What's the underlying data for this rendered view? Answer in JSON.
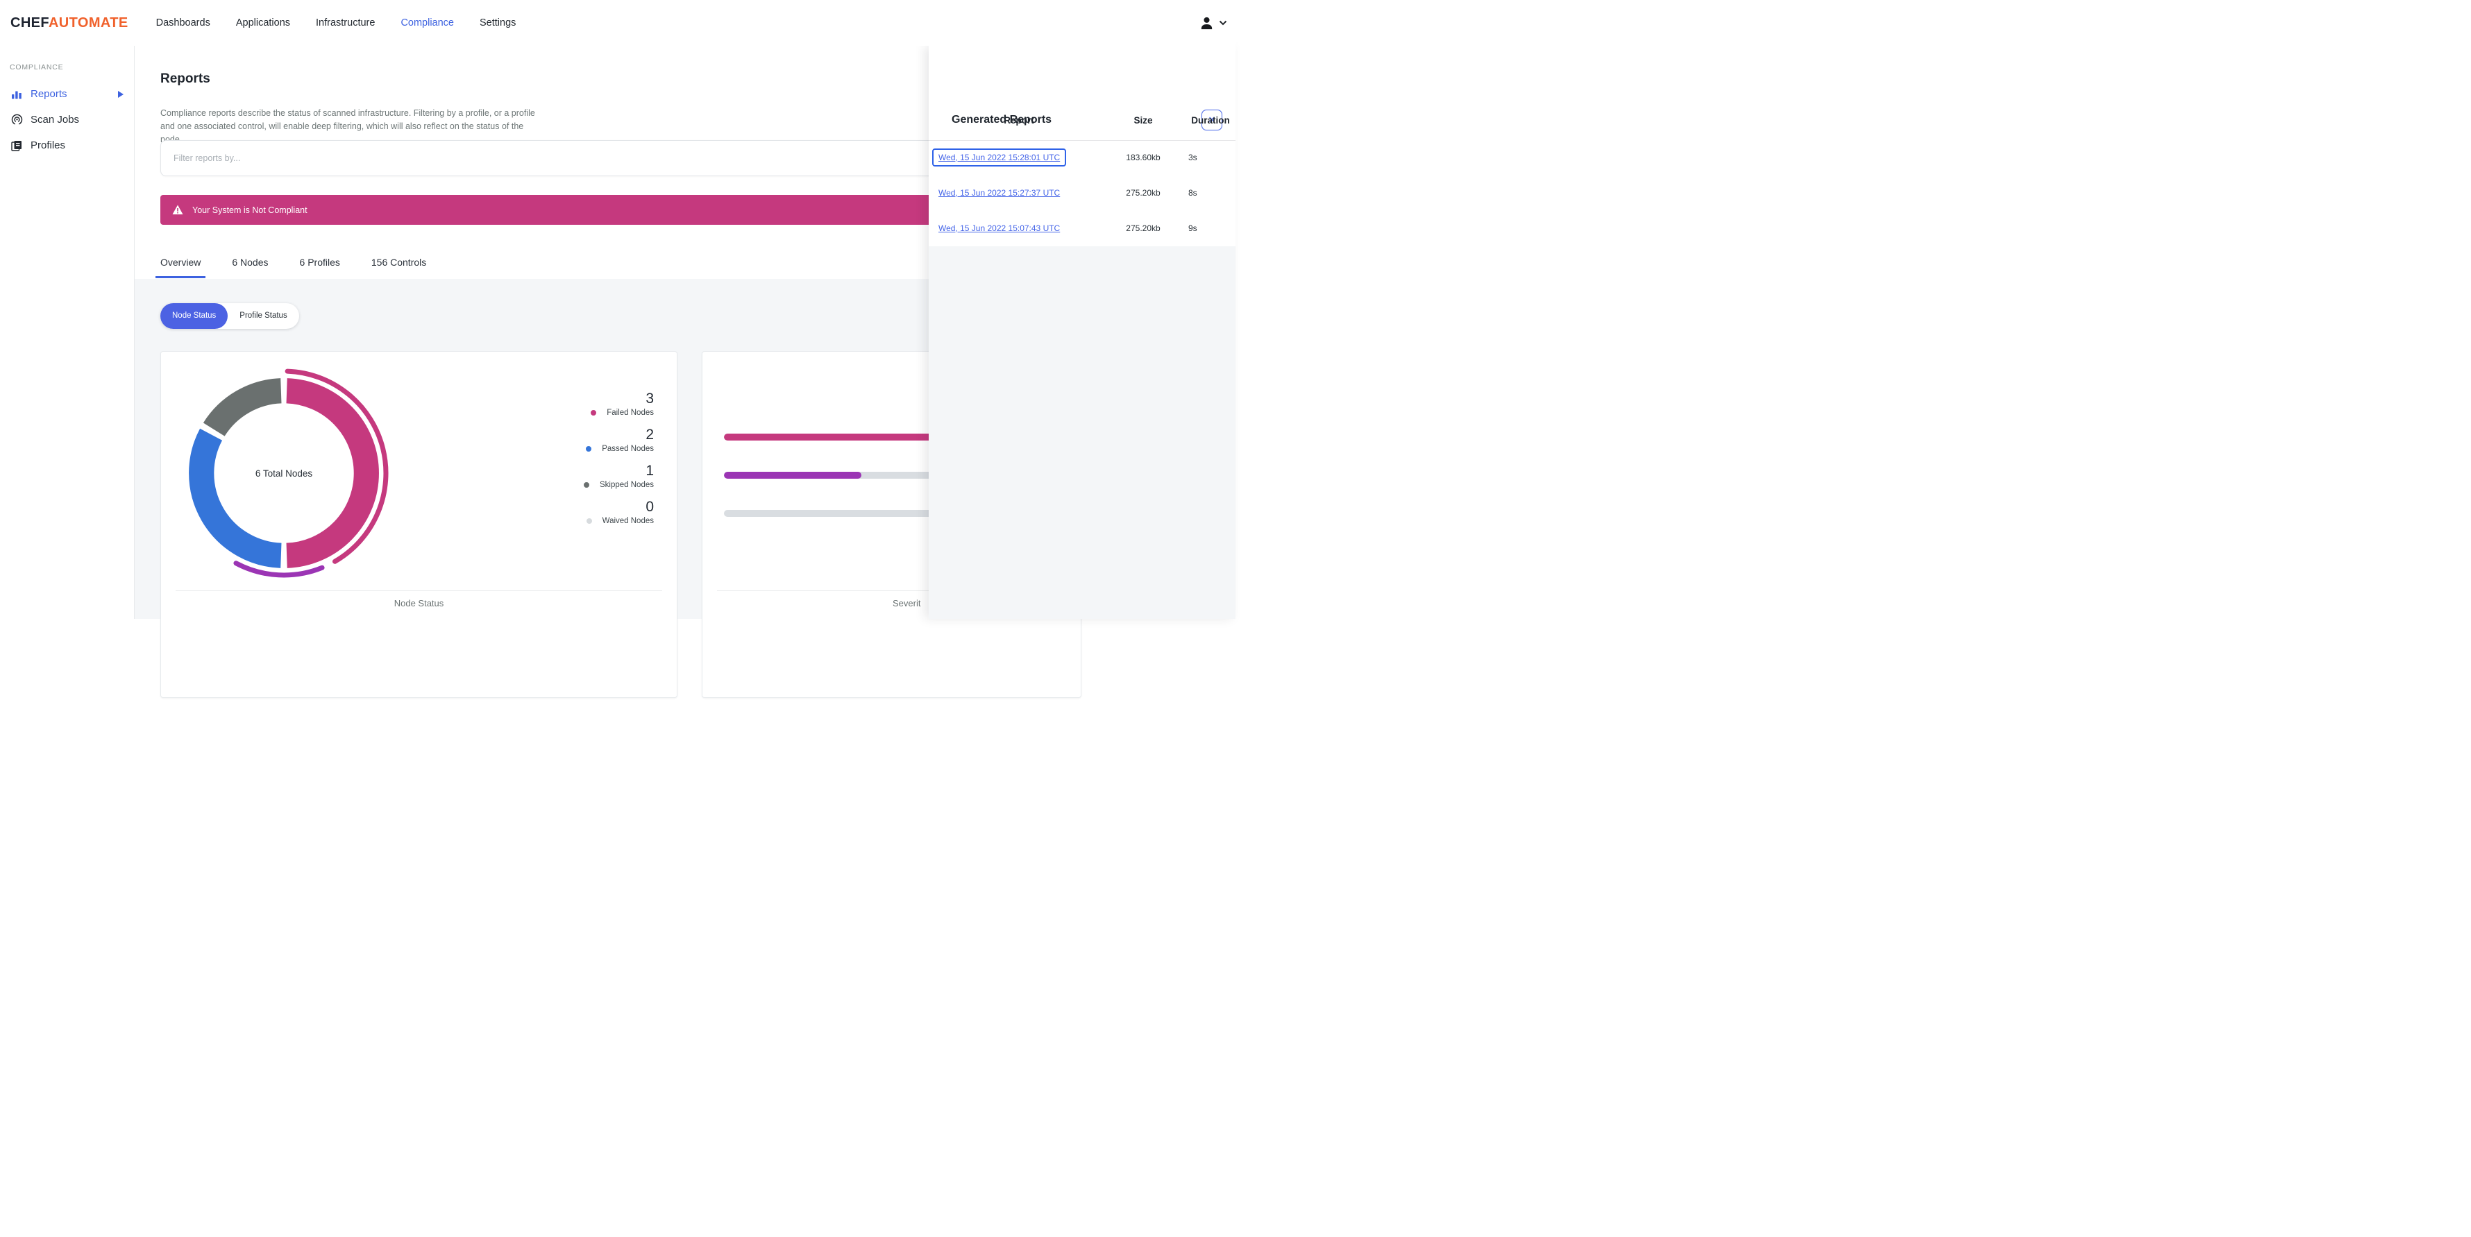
{
  "colors": {
    "primary_blue": "#3D62E0",
    "failed_pink": "#C5397E",
    "passed_blue": "#3575D9",
    "skipped_gray": "#6A706F",
    "waived_gray": "#D7DBDE",
    "critical_purple": "#9B35B4",
    "brand_orange": "#F0612C",
    "page_bg": "#F4F6F8"
  },
  "brand": {
    "chef": "CHEF",
    "automate": "AUTOMATE"
  },
  "nav": {
    "items": [
      {
        "label": "Dashboards",
        "active": false
      },
      {
        "label": "Applications",
        "active": false
      },
      {
        "label": "Infrastructure",
        "active": false
      },
      {
        "label": "Compliance",
        "active": true
      },
      {
        "label": "Settings",
        "active": false
      }
    ]
  },
  "user_menu": {
    "icon": "person-icon",
    "chevron": "chevron-down-icon"
  },
  "sidebar": {
    "section_label": "COMPLIANCE",
    "items": [
      {
        "label": "Reports",
        "icon": "bar-chart-icon",
        "active": true,
        "has_arrow": true
      },
      {
        "label": "Scan Jobs",
        "icon": "scan-radar-icon",
        "active": false
      },
      {
        "label": "Profiles",
        "icon": "profiles-icon",
        "active": false
      }
    ]
  },
  "page": {
    "title": "Reports",
    "description": "Compliance reports describe the status of scanned infrastructure. Filtering by a profile, or a profile and one associated control, will enable deep filtering, which will also reflect on the status of the node."
  },
  "filter": {
    "placeholder": "Filter reports by..."
  },
  "alert": {
    "icon": "warning-triangle-icon",
    "text": "Your System is Not Compliant"
  },
  "tabs": [
    {
      "label": "Overview",
      "active": true
    },
    {
      "label": "6 Nodes",
      "active": false
    },
    {
      "label": "6 Profiles",
      "active": false
    },
    {
      "label": "156 Controls",
      "active": false
    }
  ],
  "status_toggle": [
    {
      "label": "Node Status",
      "active": true
    },
    {
      "label": "Profile Status",
      "active": false
    }
  ],
  "node_status_card": {
    "center_label": "6 Total Nodes",
    "caption": "Node Status",
    "legend": [
      {
        "value": "3",
        "label": "Failed Nodes",
        "color": "#C5397E"
      },
      {
        "value": "2",
        "label": "Passed Nodes",
        "color": "#3575D9"
      },
      {
        "value": "1",
        "label": "Skipped Nodes",
        "color": "#6A706F"
      },
      {
        "value": "0",
        "label": "Waived Nodes",
        "color": "#D7DBDE"
      }
    ]
  },
  "severity_card": {
    "caption_visible": "Severit"
  },
  "chart_data": [
    {
      "type": "pie",
      "title": "Node Status",
      "center_label": "6 Total Nodes",
      "categories": [
        "Failed Nodes",
        "Passed Nodes",
        "Skipped Nodes",
        "Waived Nodes"
      ],
      "values": [
        3,
        2,
        1,
        0
      ],
      "total": 6,
      "colors": [
        "#C5397E",
        "#3575D9",
        "#6A706F",
        "#D7DBDE"
      ],
      "outer_arcs": [
        {
          "color": "#C5397E",
          "sweep_deg": 148
        },
        {
          "color": "#9B35B4",
          "sweep_deg": 50
        }
      ],
      "legend_position": "right"
    },
    {
      "type": "bar",
      "orientation": "horizontal",
      "title": "Severit",
      "bars": [
        {
          "color": "#C5397E",
          "fill_pct": 100
        },
        {
          "color": "#9B35B4",
          "fill_pct": 38
        },
        {
          "color": "#D9DDE1",
          "fill_pct": 0
        }
      ]
    }
  ],
  "generated_reports_panel": {
    "title": "Generated Reports",
    "close_icon": "close-icon",
    "close_glyph": "✕",
    "columns": {
      "report": "Report",
      "size": "Size",
      "duration": "Duration"
    },
    "rows": [
      {
        "report": "Wed, 15 Jun 2022 15:28:01 UTC",
        "size": "183.60kb",
        "duration": "3s",
        "selected": true
      },
      {
        "report": "Wed, 15 Jun 2022 15:27:37 UTC",
        "size": "275.20kb",
        "duration": "8s",
        "selected": false
      },
      {
        "report": "Wed, 15 Jun 2022 15:07:43 UTC",
        "size": "275.20kb",
        "duration": "9s",
        "selected": false
      }
    ]
  }
}
